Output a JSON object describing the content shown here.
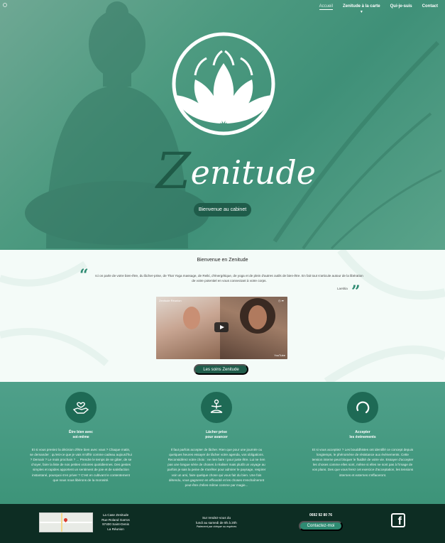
{
  "nav": {
    "items": [
      {
        "label": "Accueil"
      },
      {
        "label": "Zenitude à la carte"
      },
      {
        "label": "Qui-je-suis"
      },
      {
        "label": "Contact"
      }
    ]
  },
  "hero": {
    "brand": "enitude",
    "brand_initial": "Z",
    "button_label": "Bienvenue au cabinet"
  },
  "welcome": {
    "title": "Bienvenue en Zenitude",
    "quote": "Ici on parle de votre bien-être, du lâcher-prise, de Thaï Yoga massage, de Reiki, d'énergétique, de yoga et de plein d'autres outils de bien-être. En fait tout s'articule autour de la libération de votre potentiel en vous connectant à votre corps.",
    "quote_author": "Laetitia",
    "video_title": "Zenitude Réunion",
    "video_brand": "YouTube",
    "button_label": "Les soins Zenitude"
  },
  "features": [
    {
      "icon": "hands-heart-icon",
      "title_line1": "Être bien avec",
      "title_line2": "soi-même",
      "text": "Et si vous preniez la décision d'être bien avec vous ? Chaque matin, se demander : qu'est-ce que je vais m'offrir comme cadeau aujourd'hui ? Demain ? Le mois prochain ? ... Prendre le temps de se gâter, de se choyer, faire la liste de nos petites victoires quotidiennes. Des gestes simples et rapides apportent un sentiment de joie et de satisfaction instantané, pourquoi s'en priver ? C'est en cultivant le contentement que nous nous libérons de la morosité."
    },
    {
      "icon": "meditation-icon",
      "title_line1": "Lâcher prise",
      "title_line2": "pour avancer",
      "text": "Il faut parfois accepter de lâcher. Rien que pour une journée ou quelques heures essayer de lâcher votre agenda, vos obligations. Reconsidérez votre choix : ne rien faire ! pour juste être. Lui ne rien pas une longue série de choses à réaliser mais plutôt un voyage au parfois je sais la peine de s'arrêter pour admirer le paysage, respirer voir un ami, faire quelque chose qui vous fait du bien. Une fois détendu, vous gagnerez en efficacité et les choses s'enchaîneront peut-être d'elles-même comme par magie..."
    },
    {
      "icon": "cycle-icon",
      "title_line1": "Accepter",
      "title_line2": "les événements",
      "text": "Et si vous acceptiez ? Les bouddhistes ont identifié ce concept depuis longtemps, le phénomène de résistance aux événements. Cette tension interne peut bloquer le fluidité de votre vie. Essayer d'accepter les choses comme elles sont, même si elles ne sont pas à l'image de vos plans. Des que vous ferez cet exercice d'acceptation, les tensions internes et externes s'effaceront."
    }
  ],
  "footer": {
    "address": [
      "La Case Zenitude",
      "Rue Roland Garros",
      "97400 Saint-Denis",
      "La Réunion"
    ],
    "hours_line1": "Sur rendez-vous du",
    "hours_line2": "lundi au samedi de 8h à 20h",
    "hours_note": "Paiement par chèque ou espèces",
    "phone": "0692 92 80 76",
    "contact_button": "Contactez-moi",
    "facebook_icon": "facebook-icon"
  },
  "colors": {
    "accent": "#2e8b72",
    "dark": "#1f5c4a",
    "footer_bg": "#0d2d23"
  }
}
